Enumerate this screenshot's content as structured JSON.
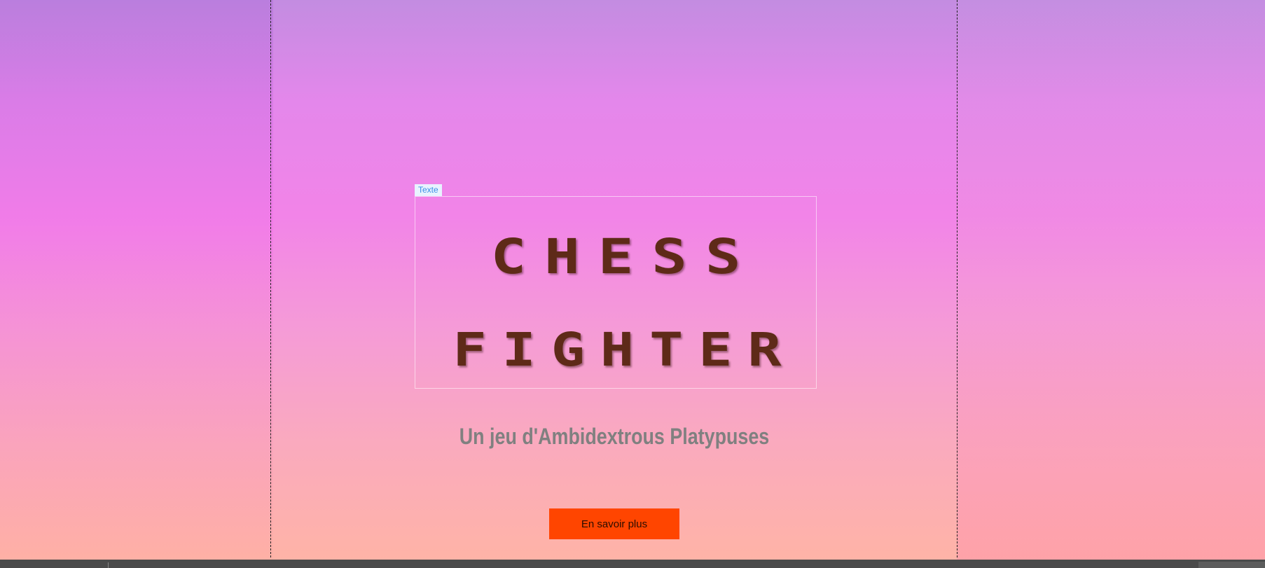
{
  "element_tag": "Texte",
  "hero": {
    "title_line_1": "CHESS",
    "title_line_2": "FIGHTER",
    "subtitle": "Un jeu d'Ambidextrous Platypuses",
    "cta_label": "En savoir plus"
  },
  "colors": {
    "title": "#5e2a18",
    "subtitle": "#808080",
    "cta_background": "#ff4500",
    "tag_text": "#3a8ee6",
    "bottom_bar": "#4a4a4a"
  }
}
